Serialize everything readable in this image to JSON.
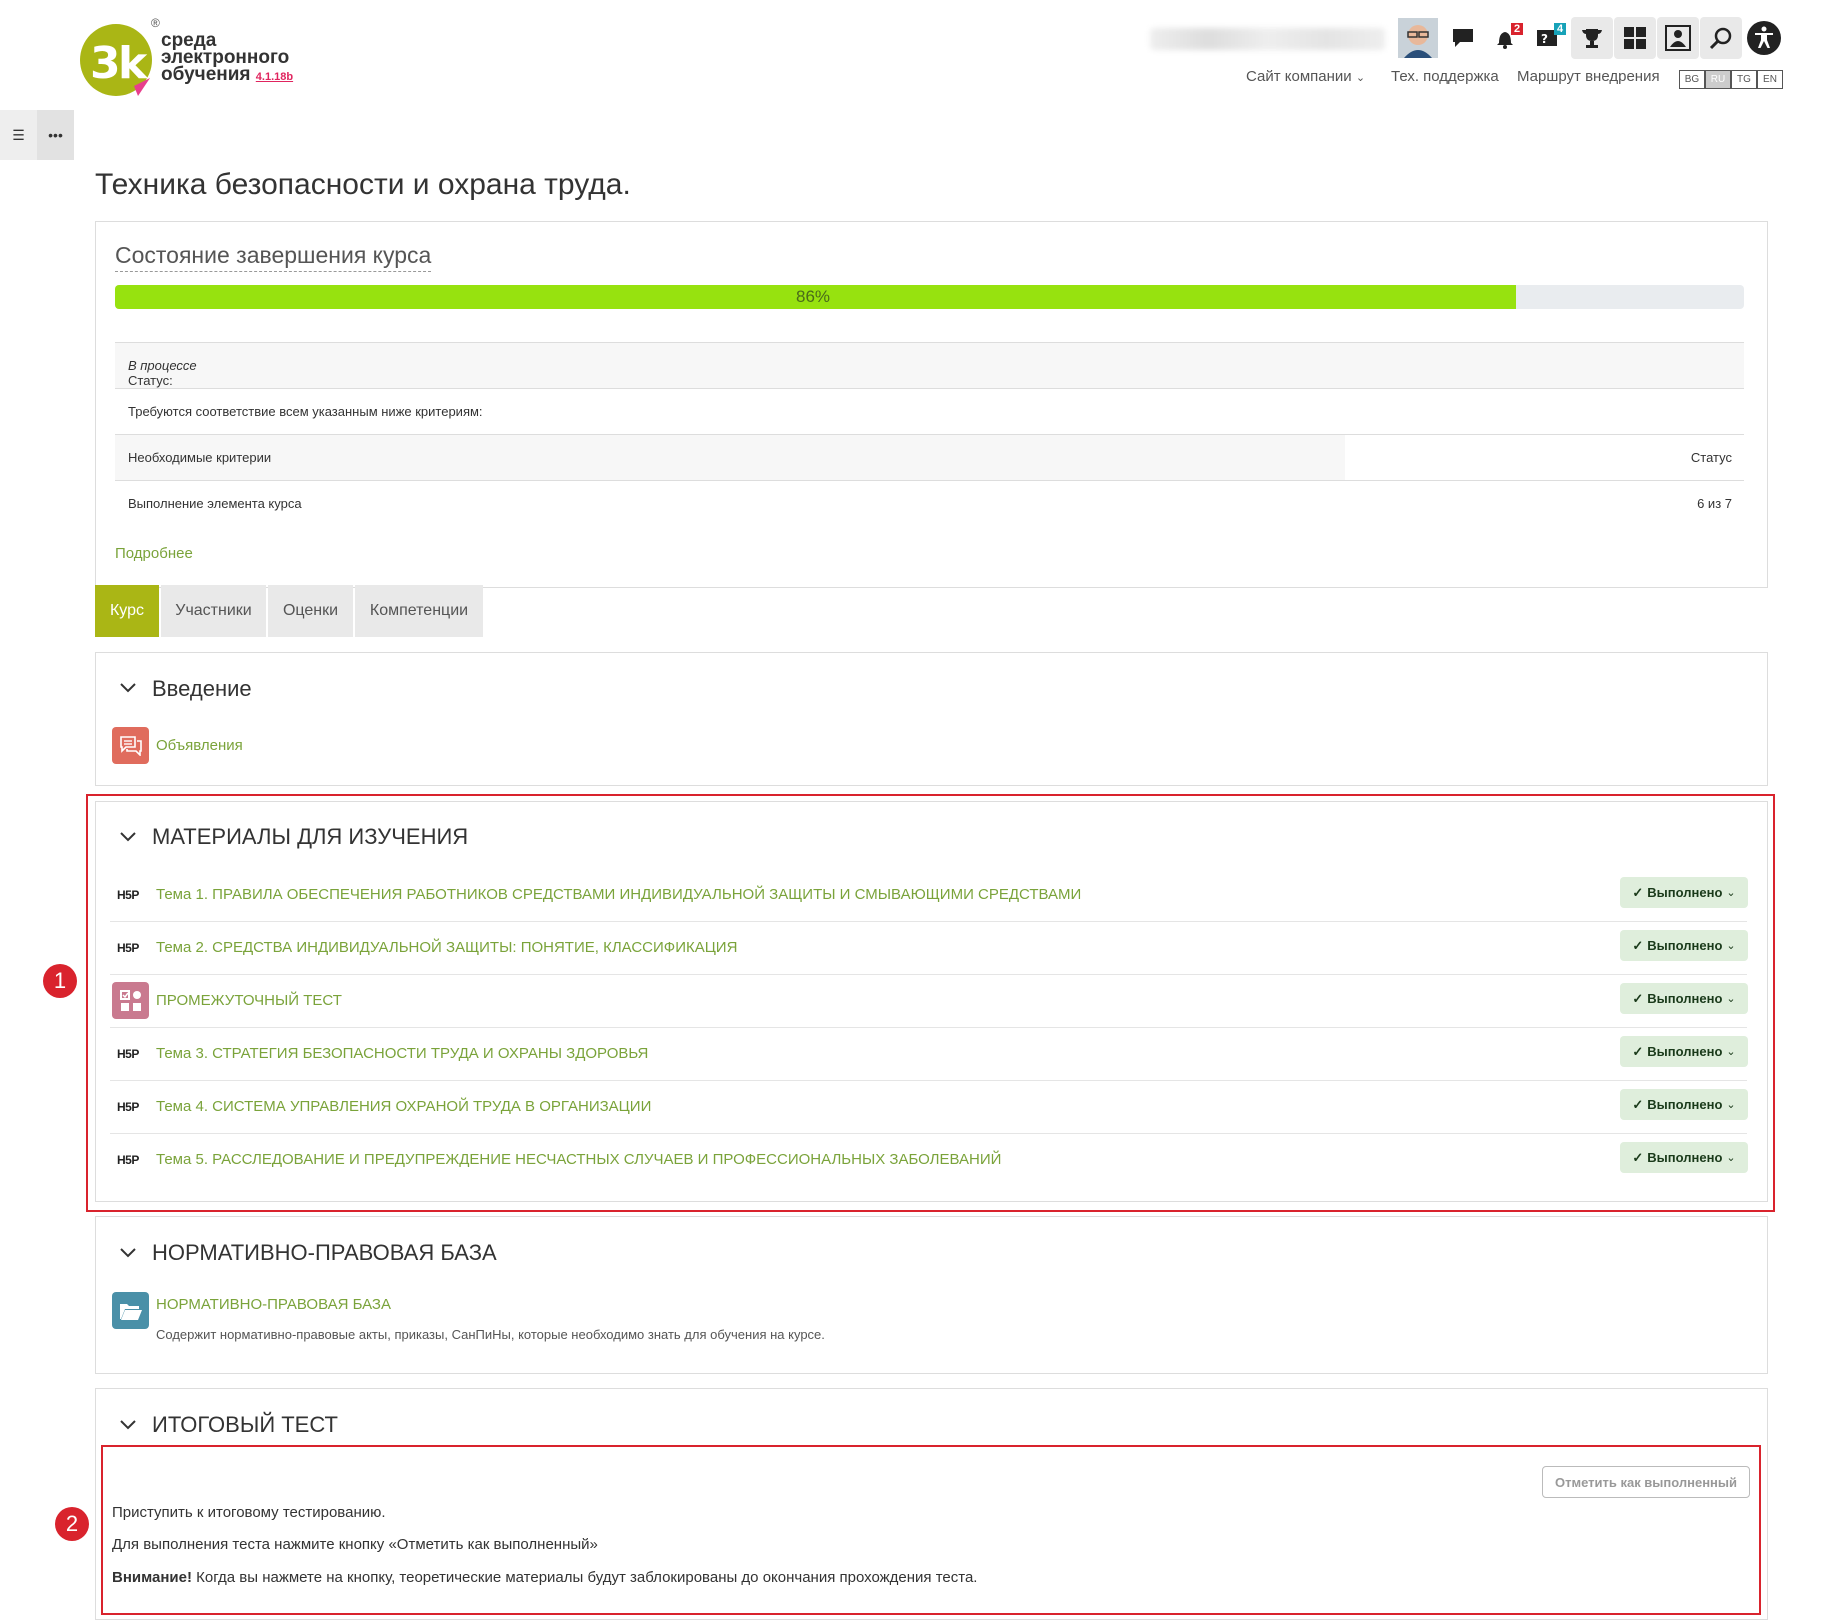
{
  "header": {
    "logo_line1": "среда",
    "logo_line2": "электронного",
    "logo_line3": "обучения",
    "logo_version": "4.1.18b",
    "logo_registered": "®",
    "nav": {
      "company_site": "Сайт компании",
      "support": "Тех. поддержка",
      "route": "Маршрут внедрения"
    },
    "languages": [
      "BG",
      "RU",
      "TG",
      "EN"
    ],
    "active_language": "RU",
    "notifications_count": "2",
    "messages_count": "4"
  },
  "page_title": "Техника безопасности и охрана труда.",
  "completion": {
    "title": "Состояние завершения курса",
    "progress_label": "86%",
    "progress_value": 86,
    "status_label": "Статус:",
    "status_value": "В процессе",
    "requirement_text": "Требуются соответствие всем указанным ниже критериям:",
    "criteria_header": "Необходимые критерии",
    "status_header": "Статус",
    "criteria_item": "Выполнение элемента курса",
    "criteria_item_status": "6 из 7",
    "more_link": "Подробнее"
  },
  "tabs": [
    "Курс",
    "Участники",
    "Оценки",
    "Компетенции"
  ],
  "sections": {
    "intro": {
      "title": "Введение",
      "activity": "Объявления"
    },
    "materials": {
      "title": "МАТЕРИАЛЫ ДЛЯ ИЗУЧЕНИЯ",
      "marker": "1",
      "items": [
        {
          "title": "Тема 1. ПРАВИЛА ОБЕСПЕЧЕНИЯ РАБОТНИКОВ СРЕДСТВАМИ ИНДИВИДУАЛЬНОЙ ЗАЩИТЫ И СМЫВАЮЩИМИ СРЕДСТВАМИ",
          "icon": "h5p-icon",
          "status": "Выполнено"
        },
        {
          "title": "Тема 2. СРЕДСТВА ИНДИВИДУАЛЬНОЙ ЗАЩИТЫ: ПОНЯТИЕ, КЛАССИФИКАЦИЯ",
          "icon": "h5p-icon",
          "status": "Выполнено"
        },
        {
          "title": "ПРОМЕЖУТОЧНЫЙ ТЕСТ",
          "icon": "quiz-icon",
          "status": "Выполнено"
        },
        {
          "title": "Тема 3. СТРАТЕГИЯ БЕЗОПАСНОСТИ ТРУДА И ОХРАНЫ ЗДОРОВЬЯ",
          "icon": "h5p-icon",
          "status": "Выполнено"
        },
        {
          "title": "Тема 4. СИСТЕМА УПРАВЛЕНИЯ ОХРАНОЙ ТРУДА В ОРГАНИЗАЦИИ",
          "icon": "h5p-icon",
          "status": "Выполнено"
        },
        {
          "title": "Тема 5. РАССЛЕДОВАНИЕ И ПРЕДУПРЕЖДЕНИЕ НЕСЧАСТНЫХ СЛУЧАЕВ И ПРОФЕССИОНАЛЬНЫХ ЗАБОЛЕВАНИЙ",
          "icon": "h5p-icon",
          "status": "Выполнено"
        }
      ]
    },
    "legal": {
      "title": "НОРМАТИВНО-ПРАВОВАЯ БАЗА",
      "activity": "НОРМАТИВНО-ПРАВОВАЯ БАЗА",
      "description": "Содержит нормативно-правовые акты, приказы, СанПиНы, которые необходимо знать для обучения на курсе."
    },
    "final": {
      "title": "ИТОГОВЫЙ ТЕСТ",
      "marker": "2",
      "mark_button": "Отметить как выполненный",
      "line1": "Приступить к итоговому тестированию.",
      "line2": "Для выполнения теста нажмите кнопку «Отметить как выполненный»",
      "warning_label": "Внимание!",
      "warning_text": " Когда вы нажмете на кнопку, теоретические материалы будут заблокированы до окончания прохождения теста."
    }
  },
  "h5p_label": "H5P",
  "colors": {
    "accent": "#aab615",
    "progress": "#97e20f",
    "link": "#7aa33a",
    "marker_red": "#d9232d"
  }
}
